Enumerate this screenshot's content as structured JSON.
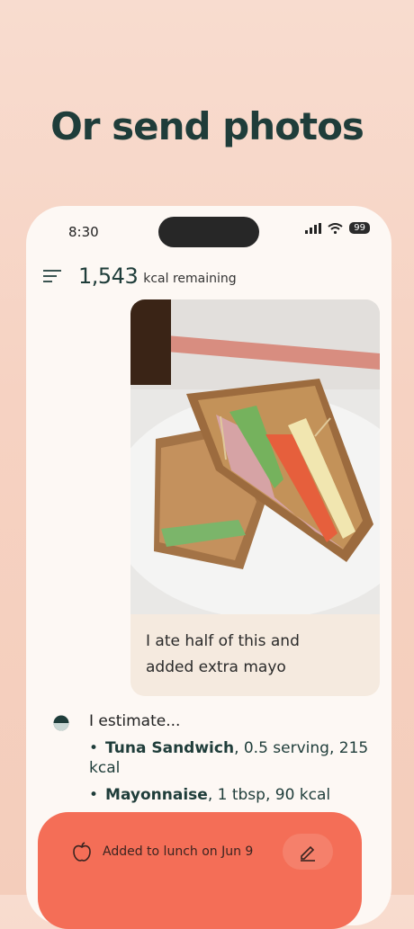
{
  "headline": "Or send photos",
  "status_bar": {
    "time": "8:30",
    "battery": "99"
  },
  "header": {
    "kcal_remaining": "1,543",
    "kcal_label": "kcal remaining"
  },
  "user_message": {
    "text_line1": "I ate half of this and",
    "text_line2": "added extra mayo",
    "photo_icon": "sandwich-photo"
  },
  "assistant_message": {
    "intro": "I estimate...",
    "items": [
      {
        "name": "Tuna Sandwich",
        "detail": ", 0.5 serving, 215 kcal"
      },
      {
        "name": "Mayonnaise",
        "detail": ", 1 tbsp, 90 kcal"
      }
    ]
  },
  "log_card": {
    "text": "Added to lunch on Jun 9",
    "icon": "apple-icon",
    "edit_icon": "pencil-icon"
  },
  "colors": {
    "accent": "#f46e57",
    "headline": "#1f3d3a",
    "bubble": "#f5eadf"
  }
}
